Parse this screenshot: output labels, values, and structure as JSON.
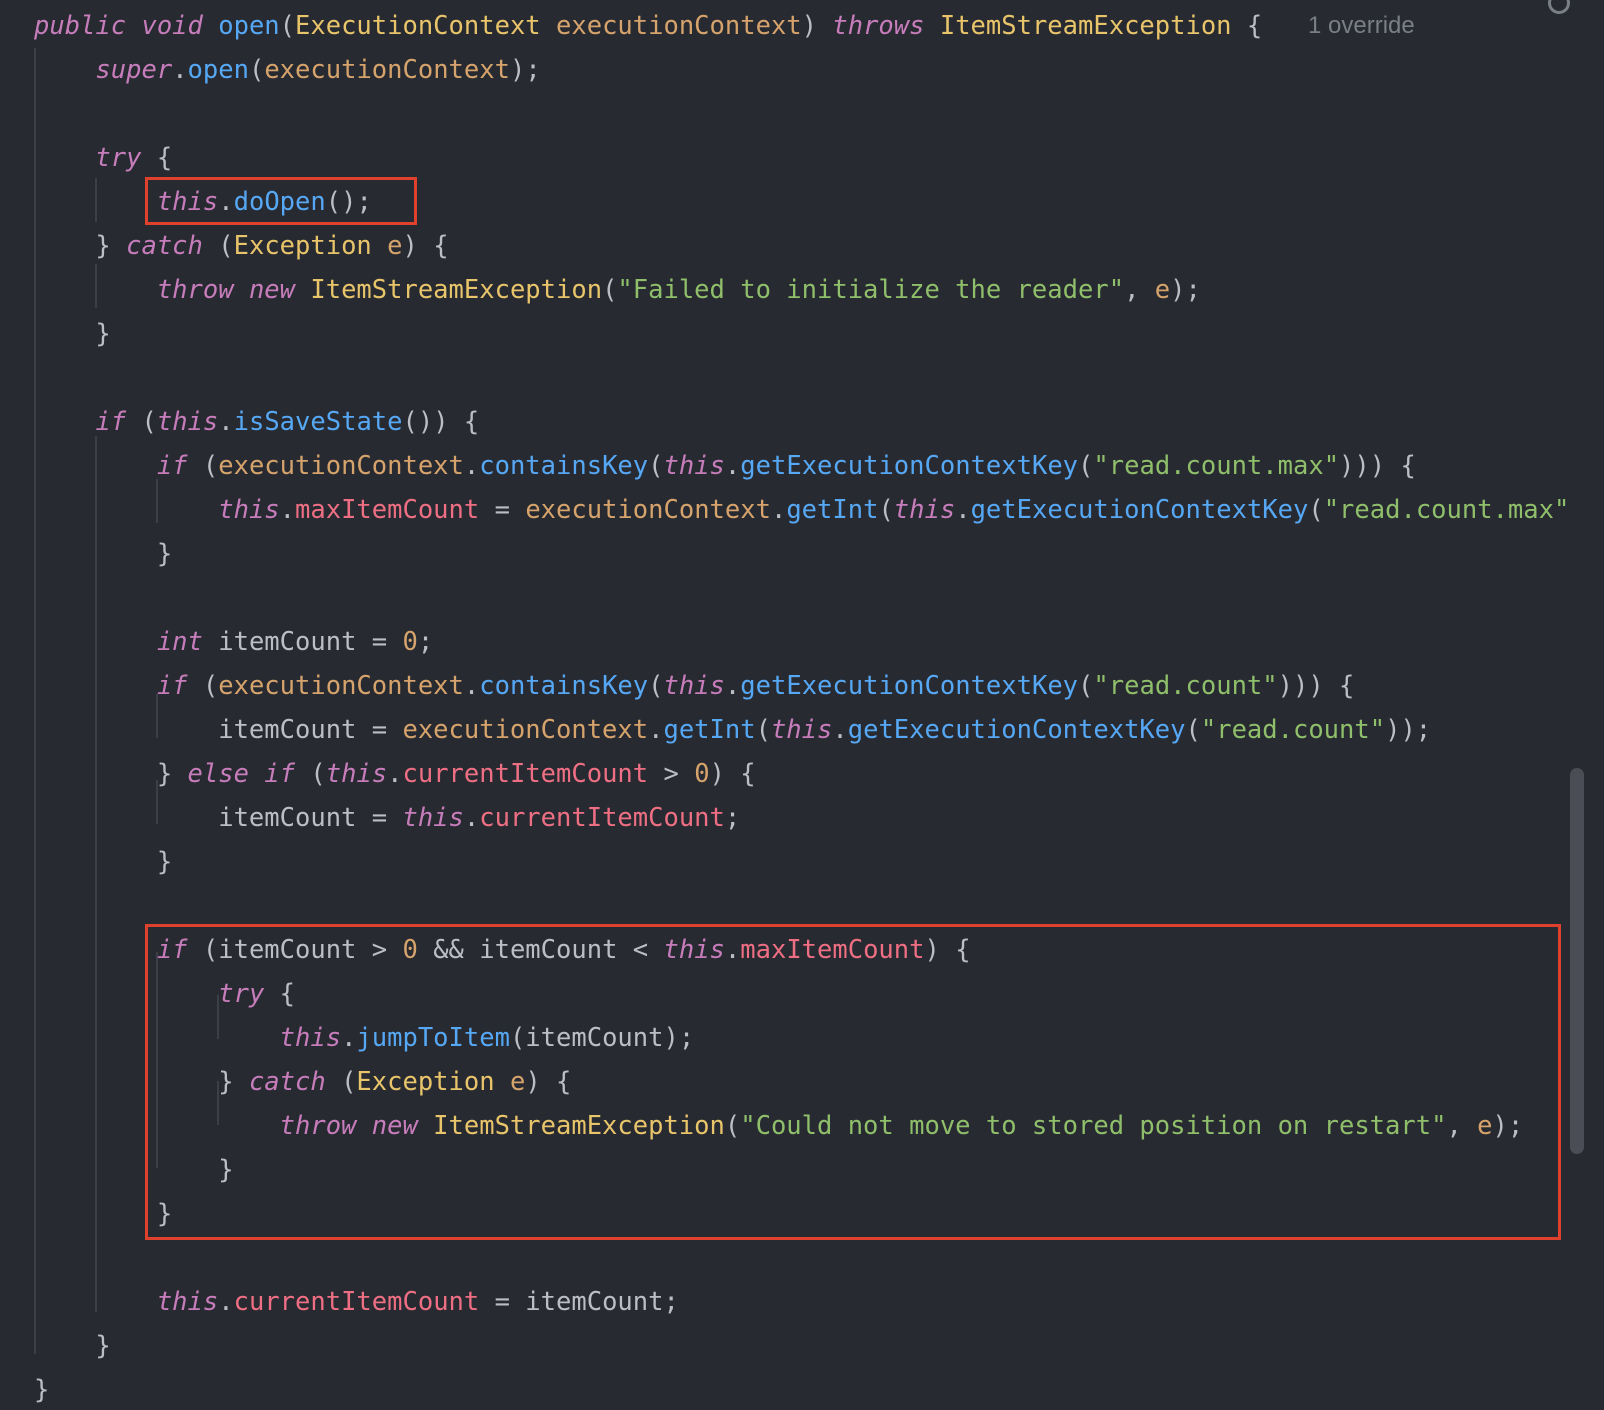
{
  "colors": {
    "background": "#282a31",
    "default": "#bcbec4",
    "keyword": "#c77dbb",
    "function": "#56a8f5",
    "type": "#e8c46a",
    "param": "#d5a36b",
    "field": "#ee6f83",
    "string": "#8fbf6a",
    "number": "#d5a36b",
    "hint": "#7a7e85",
    "highlight": "#e0412c"
  },
  "editor": {
    "inlay_hint": "1 override",
    "lines": [
      [
        [
          "public void ",
          "keyword"
        ],
        [
          "open",
          "function"
        ],
        [
          "(",
          "default"
        ],
        [
          "ExecutionContext ",
          "type"
        ],
        [
          "executionContext",
          "param"
        ],
        [
          ") ",
          "default"
        ],
        [
          "throws ",
          "keyword"
        ],
        [
          "ItemStreamException ",
          "type"
        ],
        [
          "{",
          "default"
        ]
      ],
      [
        [
          "    ",
          "default"
        ],
        [
          "super",
          "keyword"
        ],
        [
          ".",
          "default"
        ],
        [
          "open",
          "function"
        ],
        [
          "(",
          "default"
        ],
        [
          "executionContext",
          "param"
        ],
        [
          ");",
          "default"
        ]
      ],
      [],
      [
        [
          "    ",
          "default"
        ],
        [
          "try ",
          "keyword"
        ],
        [
          "{",
          "default"
        ]
      ],
      [
        [
          "        ",
          "default"
        ],
        [
          "this",
          "keyword"
        ],
        [
          ".",
          "default"
        ],
        [
          "doOpen",
          "function"
        ],
        [
          "();",
          "default"
        ]
      ],
      [
        [
          "    } ",
          "default"
        ],
        [
          "catch ",
          "keyword"
        ],
        [
          "(",
          "default"
        ],
        [
          "Exception ",
          "type"
        ],
        [
          "e",
          "param"
        ],
        [
          ") {",
          "default"
        ]
      ],
      [
        [
          "        ",
          "default"
        ],
        [
          "throw new ",
          "keyword"
        ],
        [
          "ItemStreamException",
          "type"
        ],
        [
          "(",
          "default"
        ],
        [
          "\"Failed to initialize the reader\"",
          "string"
        ],
        [
          ", ",
          "default"
        ],
        [
          "e",
          "param"
        ],
        [
          ");",
          "default"
        ]
      ],
      [
        [
          "    }",
          "default"
        ]
      ],
      [],
      [
        [
          "    ",
          "default"
        ],
        [
          "if ",
          "keyword"
        ],
        [
          "(",
          "default"
        ],
        [
          "this",
          "keyword"
        ],
        [
          ".",
          "default"
        ],
        [
          "isSaveState",
          "function"
        ],
        [
          "()) {",
          "default"
        ]
      ],
      [
        [
          "        ",
          "default"
        ],
        [
          "if ",
          "keyword"
        ],
        [
          "(",
          "default"
        ],
        [
          "executionContext",
          "param"
        ],
        [
          ".",
          "default"
        ],
        [
          "containsKey",
          "function"
        ],
        [
          "(",
          "default"
        ],
        [
          "this",
          "keyword"
        ],
        [
          ".",
          "default"
        ],
        [
          "getExecutionContextKey",
          "function"
        ],
        [
          "(",
          "default"
        ],
        [
          "\"read.count.max\"",
          "string"
        ],
        [
          "))) {",
          "default"
        ]
      ],
      [
        [
          "            ",
          "default"
        ],
        [
          "this",
          "keyword"
        ],
        [
          ".",
          "default"
        ],
        [
          "maxItemCount",
          "field"
        ],
        [
          " = ",
          "default"
        ],
        [
          "executionContext",
          "param"
        ],
        [
          ".",
          "default"
        ],
        [
          "getInt",
          "function"
        ],
        [
          "(",
          "default"
        ],
        [
          "this",
          "keyword"
        ],
        [
          ".",
          "default"
        ],
        [
          "getExecutionContextKey",
          "function"
        ],
        [
          "(",
          "default"
        ],
        [
          "\"read.count.max\"",
          "string"
        ]
      ],
      [
        [
          "        }",
          "default"
        ]
      ],
      [],
      [
        [
          "        ",
          "default"
        ],
        [
          "int ",
          "keyword"
        ],
        [
          "itemCount = ",
          "default"
        ],
        [
          "0",
          "number"
        ],
        [
          ";",
          "default"
        ]
      ],
      [
        [
          "        ",
          "default"
        ],
        [
          "if ",
          "keyword"
        ],
        [
          "(",
          "default"
        ],
        [
          "executionContext",
          "param"
        ],
        [
          ".",
          "default"
        ],
        [
          "containsKey",
          "function"
        ],
        [
          "(",
          "default"
        ],
        [
          "this",
          "keyword"
        ],
        [
          ".",
          "default"
        ],
        [
          "getExecutionContextKey",
          "function"
        ],
        [
          "(",
          "default"
        ],
        [
          "\"read.count\"",
          "string"
        ],
        [
          "))) {",
          "default"
        ]
      ],
      [
        [
          "            itemCount = ",
          "default"
        ],
        [
          "executionContext",
          "param"
        ],
        [
          ".",
          "default"
        ],
        [
          "getInt",
          "function"
        ],
        [
          "(",
          "default"
        ],
        [
          "this",
          "keyword"
        ],
        [
          ".",
          "default"
        ],
        [
          "getExecutionContextKey",
          "function"
        ],
        [
          "(",
          "default"
        ],
        [
          "\"read.count\"",
          "string"
        ],
        [
          "));",
          "default"
        ]
      ],
      [
        [
          "        } ",
          "default"
        ],
        [
          "else if ",
          "keyword"
        ],
        [
          "(",
          "default"
        ],
        [
          "this",
          "keyword"
        ],
        [
          ".",
          "default"
        ],
        [
          "currentItemCount",
          "field"
        ],
        [
          " > ",
          "default"
        ],
        [
          "0",
          "number"
        ],
        [
          ") {",
          "default"
        ]
      ],
      [
        [
          "            itemCount = ",
          "default"
        ],
        [
          "this",
          "keyword"
        ],
        [
          ".",
          "default"
        ],
        [
          "currentItemCount",
          "field"
        ],
        [
          ";",
          "default"
        ]
      ],
      [
        [
          "        }",
          "default"
        ]
      ],
      [],
      [
        [
          "        ",
          "default"
        ],
        [
          "if ",
          "keyword"
        ],
        [
          "(itemCount > ",
          "default"
        ],
        [
          "0",
          "number"
        ],
        [
          " && itemCount < ",
          "default"
        ],
        [
          "this",
          "keyword"
        ],
        [
          ".",
          "default"
        ],
        [
          "maxItemCount",
          "field"
        ],
        [
          ") {",
          "default"
        ]
      ],
      [
        [
          "            ",
          "default"
        ],
        [
          "try ",
          "keyword"
        ],
        [
          "{",
          "default"
        ]
      ],
      [
        [
          "                ",
          "default"
        ],
        [
          "this",
          "keyword"
        ],
        [
          ".",
          "default"
        ],
        [
          "jumpToItem",
          "function"
        ],
        [
          "(itemCount);",
          "default"
        ]
      ],
      [
        [
          "            } ",
          "default"
        ],
        [
          "catch ",
          "keyword"
        ],
        [
          "(",
          "default"
        ],
        [
          "Exception ",
          "type"
        ],
        [
          "e",
          "param"
        ],
        [
          ") {",
          "default"
        ]
      ],
      [
        [
          "                ",
          "default"
        ],
        [
          "throw new ",
          "keyword"
        ],
        [
          "ItemStreamException",
          "type"
        ],
        [
          "(",
          "default"
        ],
        [
          "\"Could not move to stored position on restart\"",
          "string"
        ],
        [
          ", ",
          "default"
        ],
        [
          "e",
          "param"
        ],
        [
          ");",
          "default"
        ]
      ],
      [
        [
          "            }",
          "default"
        ]
      ],
      [
        [
          "        }",
          "default"
        ]
      ],
      [],
      [
        [
          "        ",
          "default"
        ],
        [
          "this",
          "keyword"
        ],
        [
          ".",
          "default"
        ],
        [
          "currentItemCount",
          "field"
        ],
        [
          " = itemCount;",
          "default"
        ]
      ],
      [
        [
          "    }",
          "default"
        ]
      ],
      [
        [
          "}",
          "default"
        ]
      ]
    ]
  }
}
